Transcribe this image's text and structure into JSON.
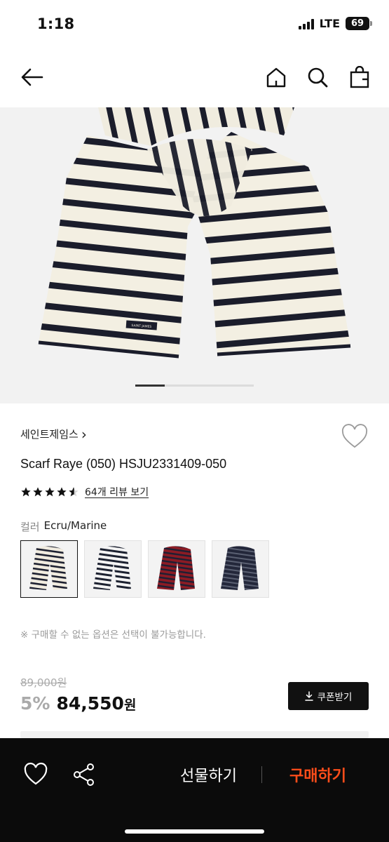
{
  "status_bar": {
    "time": "1:18",
    "network": "LTE",
    "battery": "69"
  },
  "nav": {
    "icons": [
      "back-arrow-icon",
      "home-icon",
      "search-icon",
      "shopping-bag-icon"
    ]
  },
  "product": {
    "brand": "세인트제임스",
    "brand_chevron": "›",
    "title": "Scarf Raye (050) HSJU2331409-050",
    "rating": 4.5,
    "review_link": "64개 리뷰 보기",
    "color_label": "컬러",
    "color_value": "Ecru/Marine",
    "label_on_scarf": "SAINT JAMES",
    "swatches": [
      {
        "name": "Ecru/Marine",
        "base": "#f1ece0",
        "stripe": "#1d2030"
      },
      {
        "name": "Navy/White",
        "base": "#f4f4f4",
        "stripe": "#1c2130"
      },
      {
        "name": "Red/Navy",
        "base": "#8c1b24",
        "stripe": "#1e1f33"
      },
      {
        "name": "Navy/Gray",
        "base": "#23273a",
        "stripe": "#5a6072"
      }
    ],
    "notice": "※ 구매할 수 없는 옵션은 선택이 불가능합니다.",
    "original_price": "89,000원",
    "discount": "5%",
    "price": "84,550",
    "price_unit": "원",
    "coupon_label": "쿠폰받기"
  },
  "bottom_bar": {
    "gift_label": "선물하기",
    "buy_label": "구매하기",
    "buy_color": "#ff4d1a"
  }
}
